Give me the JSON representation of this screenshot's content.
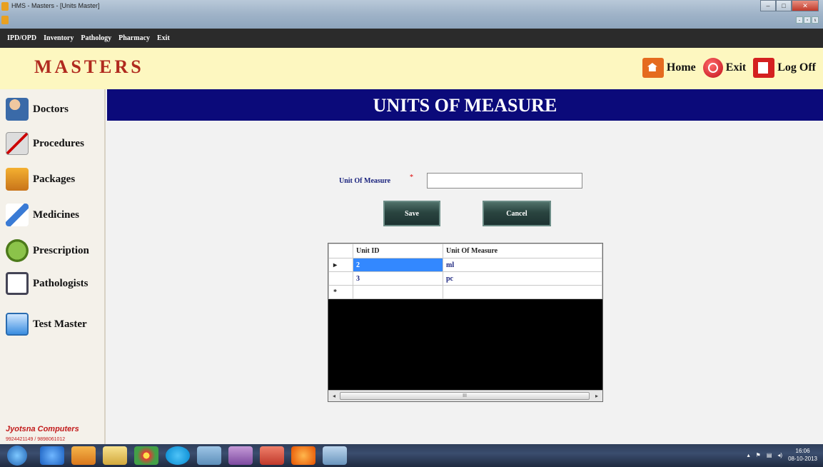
{
  "window": {
    "title": "HMS - Masters - [Units Master]"
  },
  "menu": [
    "IPD/OPD",
    "Inventory",
    "Pathology",
    "Pharmacy",
    "Exit"
  ],
  "header": {
    "brand": "MASTERS",
    "home_label": "Home",
    "exit_label": "Exit",
    "logoff_label": "Log Off"
  },
  "sidebar": {
    "items": [
      {
        "label": "Doctors",
        "icon": "doctor-icon"
      },
      {
        "label": "Procedures",
        "icon": "scalpel-icon"
      },
      {
        "label": "Packages",
        "icon": "package-icon"
      },
      {
        "label": "Medicines",
        "icon": "syringe-icon"
      },
      {
        "label": "Prescription",
        "icon": "prescription-icon"
      },
      {
        "label": "Pathologists",
        "icon": "heartbeat-monitor-icon"
      },
      {
        "label": "Test Master",
        "icon": "flask-icon"
      }
    ],
    "credit_name": "Jyotsna Computers",
    "credit_phone": "9924421149 / 9898061012"
  },
  "page": {
    "title": "UNITS OF MEASURE"
  },
  "form": {
    "uom_label": "Unit Of Measure",
    "required_mark": "*",
    "uom_value": "",
    "save_label": "Save",
    "cancel_label": "Cancel"
  },
  "grid": {
    "columns": [
      "Unit ID",
      "Unit Of Measure"
    ],
    "rows": [
      {
        "marker": "▸",
        "id": "2",
        "unit": "ml"
      },
      {
        "marker": "",
        "id": "3",
        "unit": "pc"
      }
    ],
    "new_row_marker": "*",
    "scroll_thumb_text": "III"
  },
  "taskbar": {
    "time": "16:06",
    "date": "08-10-2013"
  }
}
